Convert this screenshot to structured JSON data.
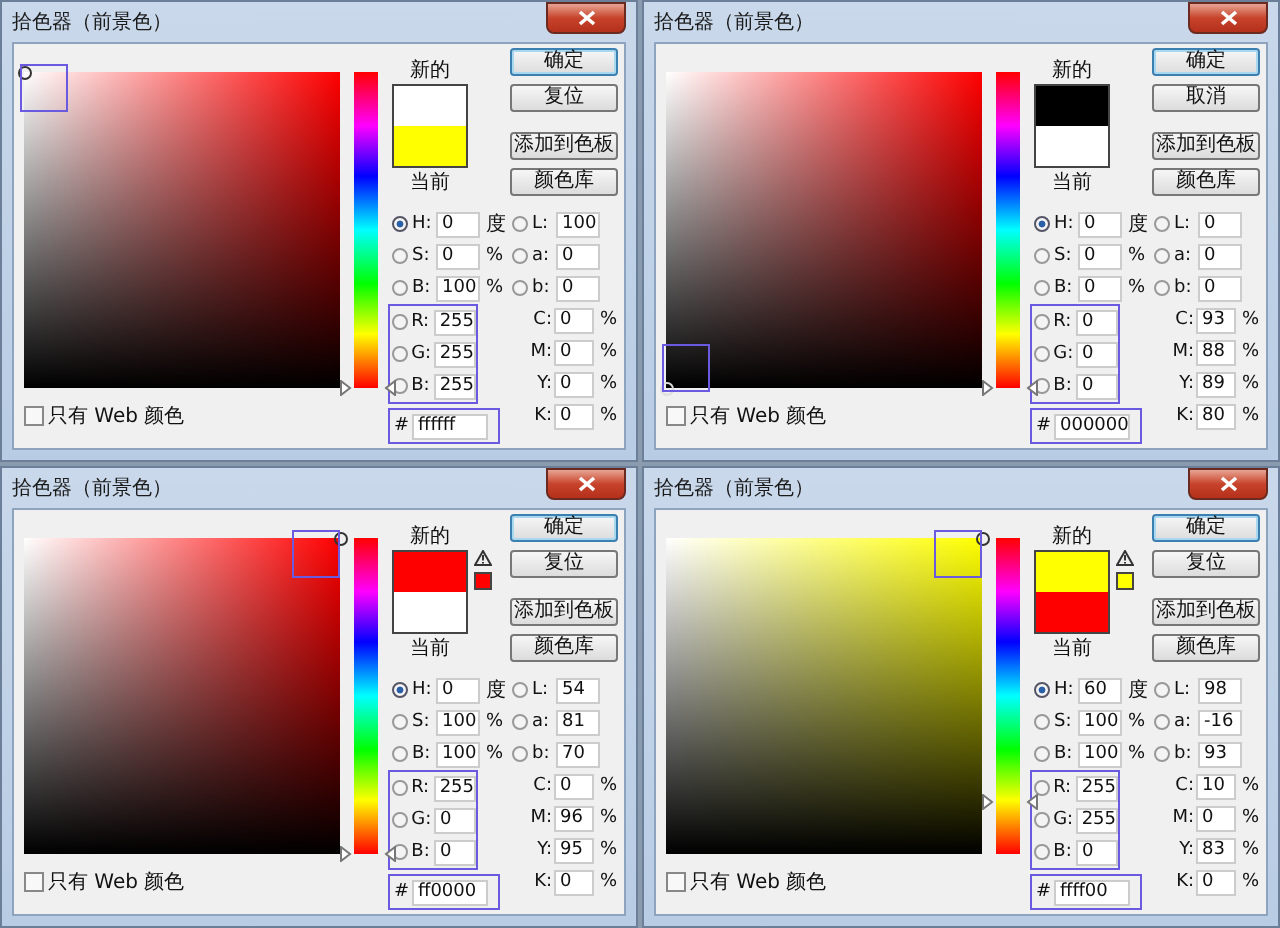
{
  "dialogs": [
    {
      "title": "拾色器（前景色）",
      "new_label": "新的",
      "current_label": "当前",
      "current_swatch": {
        "color": "#ffff00"
      },
      "hue_slider": {
        "level": 0
      },
      "gamut_warning": false,
      "marker_highlighted": true,
      "rgb_highlighted": true,
      "hex_highlighted": true,
      "buttons": [
        {
          "label": "确定",
          "default": true
        },
        {
          "label": "复位",
          "default": false
        },
        {
          "label": "添加到色板",
          "default": false
        },
        {
          "label": "颜色库",
          "default": false
        }
      ],
      "hsb": [
        {
          "label": "H:",
          "value": "0",
          "unit": "度",
          "selected": true
        },
        {
          "label": "S:",
          "value": "0",
          "unit": "%",
          "selected": false
        },
        {
          "label": "B:",
          "value": "100",
          "unit": "%",
          "selected": false
        }
      ],
      "lab": [
        {
          "label": "L:",
          "value": "100",
          "selected": false
        },
        {
          "label": "a:",
          "value": "0",
          "selected": false
        },
        {
          "label": "b:",
          "value": "0",
          "selected": false
        }
      ],
      "rgb": [
        {
          "label": "R:",
          "value": "255",
          "selected": false
        },
        {
          "label": "G:",
          "value": "255",
          "selected": false
        },
        {
          "label": "B:",
          "value": "255",
          "selected": false
        }
      ],
      "cmyk": [
        {
          "label": "C:",
          "value": "0",
          "unit": "%"
        },
        {
          "label": "M:",
          "value": "0",
          "unit": "%"
        },
        {
          "label": "Y:",
          "value": "0",
          "unit": "%"
        },
        {
          "label": "K:",
          "value": "0",
          "unit": "%"
        }
      ],
      "hex": {
        "label": "#",
        "value": "ffffff"
      },
      "web_only": {
        "label": "只有 Web 颜色",
        "checked": false
      }
    },
    {
      "title": "拾色器（前景色）",
      "new_label": "新的",
      "current_label": "当前",
      "current_swatch": {
        "color": "#ffffff"
      },
      "hue_slider": {
        "level": 0
      },
      "gamut_warning": false,
      "marker_highlighted": true,
      "rgb_highlighted": true,
      "hex_highlighted": true,
      "buttons": [
        {
          "label": "确定",
          "default": true
        },
        {
          "label": "取消",
          "default": false
        },
        {
          "label": "添加到色板",
          "default": false
        },
        {
          "label": "颜色库",
          "default": false
        }
      ],
      "hsb": [
        {
          "label": "H:",
          "value": "0",
          "unit": "度",
          "selected": true
        },
        {
          "label": "S:",
          "value": "0",
          "unit": "%",
          "selected": false
        },
        {
          "label": "B:",
          "value": "0",
          "unit": "%",
          "selected": false
        }
      ],
      "lab": [
        {
          "label": "L:",
          "value": "0",
          "selected": false
        },
        {
          "label": "a:",
          "value": "0",
          "selected": false
        },
        {
          "label": "b:",
          "value": "0",
          "selected": false
        }
      ],
      "rgb": [
        {
          "label": "R:",
          "value": "0",
          "selected": false
        },
        {
          "label": "G:",
          "value": "0",
          "selected": false
        },
        {
          "label": "B:",
          "value": "0",
          "selected": false
        }
      ],
      "cmyk": [
        {
          "label": "C:",
          "value": "93",
          "unit": "%"
        },
        {
          "label": "M:",
          "value": "88",
          "unit": "%"
        },
        {
          "label": "Y:",
          "value": "89",
          "unit": "%"
        },
        {
          "label": "K:",
          "value": "80",
          "unit": "%"
        }
      ],
      "hex": {
        "label": "#",
        "value": "000000"
      },
      "web_only": {
        "label": "只有 Web 颜色",
        "checked": false
      }
    },
    {
      "title": "拾色器（前景色）",
      "new_label": "新的",
      "current_label": "当前",
      "current_swatch": {
        "color": "#ffffff"
      },
      "hue_slider": {
        "level": 0
      },
      "gamut_warning": true,
      "marker_highlighted": true,
      "rgb_highlighted": true,
      "hex_highlighted": true,
      "buttons": [
        {
          "label": "确定",
          "default": true
        },
        {
          "label": "复位",
          "default": false
        },
        {
          "label": "添加到色板",
          "default": false
        },
        {
          "label": "颜色库",
          "default": false
        }
      ],
      "hsb": [
        {
          "label": "H:",
          "value": "0",
          "unit": "度",
          "selected": true
        },
        {
          "label": "S:",
          "value": "100",
          "unit": "%",
          "selected": false
        },
        {
          "label": "B:",
          "value": "100",
          "unit": "%",
          "selected": false
        }
      ],
      "lab": [
        {
          "label": "L:",
          "value": "54",
          "selected": false
        },
        {
          "label": "a:",
          "value": "81",
          "selected": false
        },
        {
          "label": "b:",
          "value": "70",
          "selected": false
        }
      ],
      "rgb": [
        {
          "label": "R:",
          "value": "255",
          "selected": false
        },
        {
          "label": "G:",
          "value": "0",
          "selected": false
        },
        {
          "label": "B:",
          "value": "0",
          "selected": false
        }
      ],
      "cmyk": [
        {
          "label": "C:",
          "value": "0",
          "unit": "%"
        },
        {
          "label": "M:",
          "value": "96",
          "unit": "%"
        },
        {
          "label": "Y:",
          "value": "95",
          "unit": "%"
        },
        {
          "label": "K:",
          "value": "0",
          "unit": "%"
        }
      ],
      "hex": {
        "label": "#",
        "value": "ff0000"
      },
      "web_only": {
        "label": "只有 Web 颜色",
        "checked": false
      }
    },
    {
      "title": "拾色器（前景色）",
      "new_label": "新的",
      "current_label": "当前",
      "current_swatch": {
        "color": "#ff0000"
      },
      "hue_slider": {
        "level": 0.167
      },
      "gamut_warning": true,
      "marker_highlighted": true,
      "rgb_highlighted": true,
      "hex_highlighted": true,
      "buttons": [
        {
          "label": "确定",
          "default": true
        },
        {
          "label": "复位",
          "default": false
        },
        {
          "label": "添加到色板",
          "default": false
        },
        {
          "label": "颜色库",
          "default": false
        }
      ],
      "hsb": [
        {
          "label": "H:",
          "value": "60",
          "unit": "度",
          "selected": true
        },
        {
          "label": "S:",
          "value": "100",
          "unit": "%",
          "selected": false
        },
        {
          "label": "B:",
          "value": "100",
          "unit": "%",
          "selected": false
        }
      ],
      "lab": [
        {
          "label": "L:",
          "value": "98",
          "selected": false
        },
        {
          "label": "a:",
          "value": "-16",
          "selected": false
        },
        {
          "label": "b:",
          "value": "93",
          "selected": false
        }
      ],
      "rgb": [
        {
          "label": "R:",
          "value": "255",
          "selected": false
        },
        {
          "label": "G:",
          "value": "255",
          "selected": false
        },
        {
          "label": "B:",
          "value": "0",
          "selected": false
        }
      ],
      "cmyk": [
        {
          "label": "C:",
          "value": "10",
          "unit": "%"
        },
        {
          "label": "M:",
          "value": "0",
          "unit": "%"
        },
        {
          "label": "Y:",
          "value": "83",
          "unit": "%"
        },
        {
          "label": "K:",
          "value": "0",
          "unit": "%"
        }
      ],
      "hex": {
        "label": "#",
        "value": "ffff00"
      },
      "web_only": {
        "label": "只有 Web 颜色",
        "checked": false
      }
    }
  ]
}
